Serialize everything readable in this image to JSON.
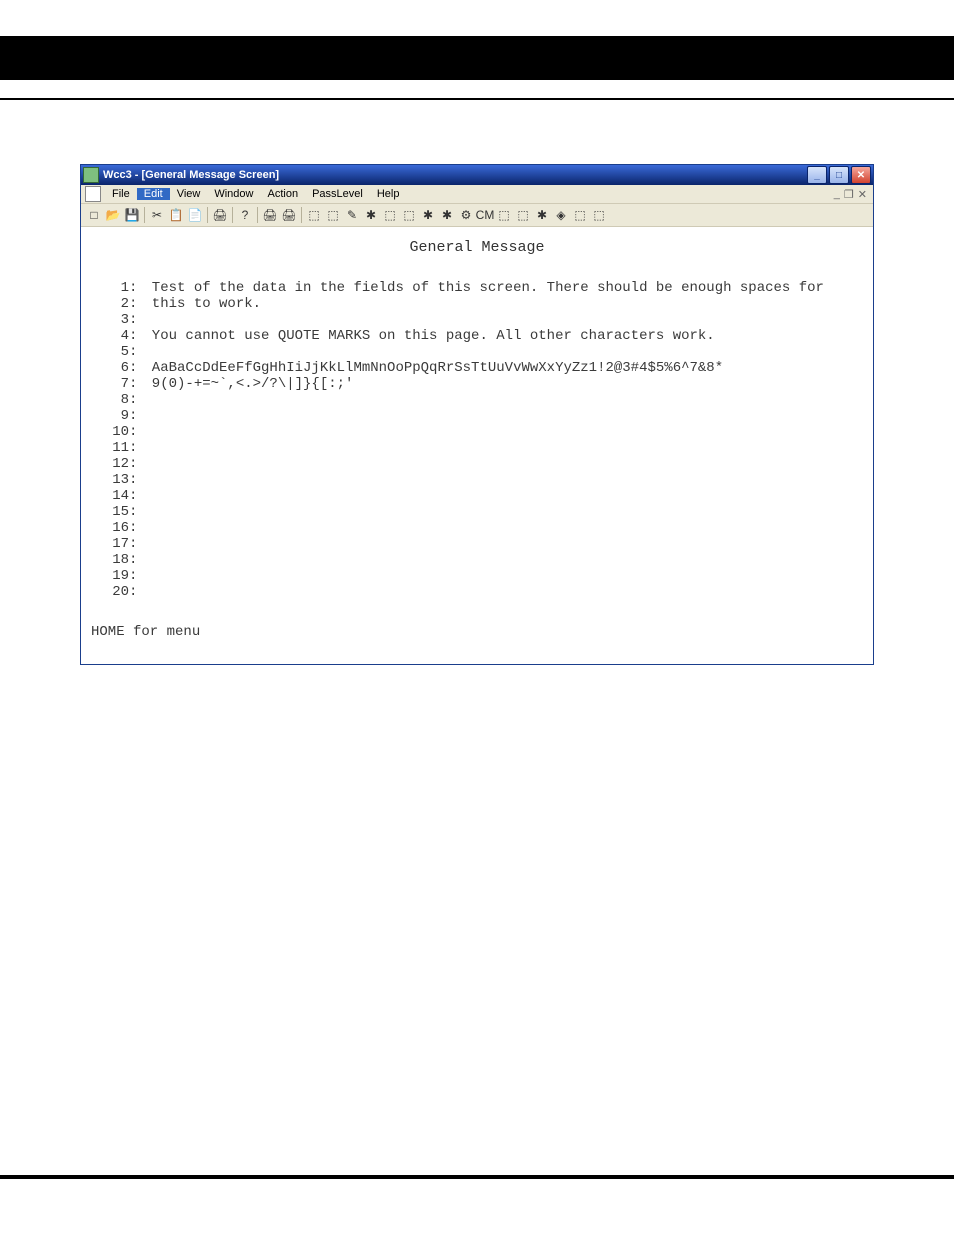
{
  "window": {
    "title": "Wcc3 - [General Message Screen]",
    "controls": {
      "min": "_",
      "max": "□",
      "close": "✕"
    }
  },
  "menu": {
    "items": [
      "File",
      "Edit",
      "View",
      "Window",
      "Action",
      "PassLevel",
      "Help"
    ],
    "highlight_index": 1,
    "mdi_right": {
      "min": "_",
      "restore": "❐",
      "close": "✕"
    }
  },
  "toolbar": {
    "icons": [
      "□",
      "📂",
      "💾",
      "✂",
      "📋",
      "📄",
      "🖨",
      "?",
      "🖨",
      "🖨",
      "⬚",
      "⬚",
      "✎",
      "✱",
      "⬚",
      "⬚",
      "✱",
      "✱",
      "⚙",
      "CM",
      "⬚",
      "⬚",
      "✱",
      "◈",
      "⬚",
      "⬚"
    ]
  },
  "doc": {
    "heading": "General Message",
    "lines": [
      "Test of the data in the fields of this screen. There should be enough spaces for",
      "this to work.",
      "",
      "You cannot use QUOTE MARKS on this page. All other characters work.",
      "",
      "AaBaCcDdEeFfGgHhIiJjKkLlMmNnOoPpQqRrSsTtUuVvWwXxYyZz1!2@3#4$5%6^7&8*",
      "9(0)-+=~`,<.>/?\\|]}{[:;'",
      "",
      "",
      "",
      "",
      "",
      "",
      "",
      "",
      "",
      "",
      "",
      "",
      ""
    ],
    "footer": "HOME for menu"
  }
}
